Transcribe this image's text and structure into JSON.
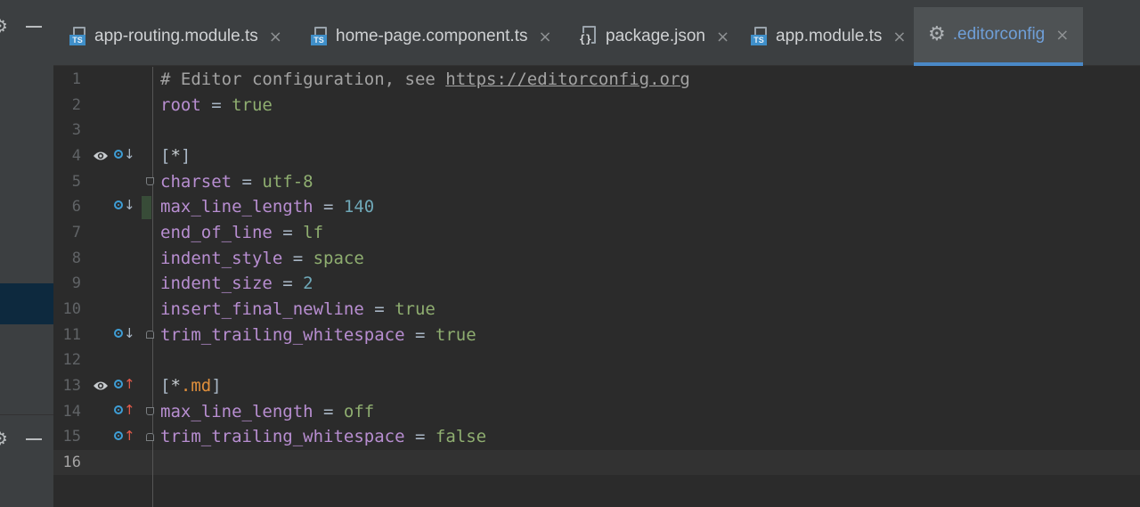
{
  "tabs": [
    {
      "label": "app-routing.module.ts",
      "icon": "ts-file-icon",
      "active": false
    },
    {
      "label": "home-page.component.ts",
      "icon": "ts-file-icon",
      "active": false
    },
    {
      "label": "package.json",
      "icon": "json-file-icon",
      "active": false
    },
    {
      "label": "app.module.ts",
      "icon": "ts-file-icon",
      "active": false
    },
    {
      "label": ".editorconfig",
      "icon": "gear-icon",
      "active": true
    }
  ],
  "tab_close_glyph": "×",
  "icons": {
    "ts_badge": "TS",
    "json_braces": "{}",
    "gear": "⚙",
    "panel_minus": "minus-icon"
  },
  "colors": {
    "editor_bg": "#2b2b2b",
    "active_tab_accent": "#4a88c7",
    "key": "#b88ed1",
    "value": "#8fae70",
    "number": "#6fa8b8",
    "comment": "#a3a3a3"
  },
  "editor": {
    "line_numbers": [
      "1",
      "2",
      "3",
      "4",
      "5",
      "6",
      "7",
      "8",
      "9",
      "10",
      "11",
      "12",
      "13",
      "14",
      "15",
      "16"
    ],
    "current_line": "16",
    "lines": {
      "l1": {
        "comment": "# Editor configuration, see ",
        "url": "https://editorconfig.org"
      },
      "l2": {
        "key": "root",
        "op": " = ",
        "val": "true"
      },
      "l4": {
        "open": "[",
        "sec": "*",
        "close": "]"
      },
      "l5": {
        "key": "charset",
        "op": " = ",
        "val": "utf-8"
      },
      "l6": {
        "key": "max_line_length",
        "op": " = ",
        "val": "140"
      },
      "l7": {
        "key": "end_of_line",
        "op": " = ",
        "val": "lf"
      },
      "l8": {
        "key": "indent_style",
        "op": " = ",
        "val": "space"
      },
      "l9": {
        "key": "indent_size",
        "op": " = ",
        "val": "2"
      },
      "l10": {
        "key": "insert_final_newline",
        "op": " = ",
        "val": "true"
      },
      "l11": {
        "key": "trim_trailing_whitespace",
        "op": " = ",
        "val": "true"
      },
      "l13": {
        "open": "[",
        "sec": "*",
        "ext": ".md",
        "close": "]"
      },
      "l14": {
        "key": "max_line_length",
        "op": " = ",
        "val": "off"
      },
      "l15": {
        "key": "trim_trailing_whitespace",
        "op": " = ",
        "val": "false"
      }
    },
    "gutter_arrows": {
      "down": "↓",
      "up": "↑"
    }
  }
}
